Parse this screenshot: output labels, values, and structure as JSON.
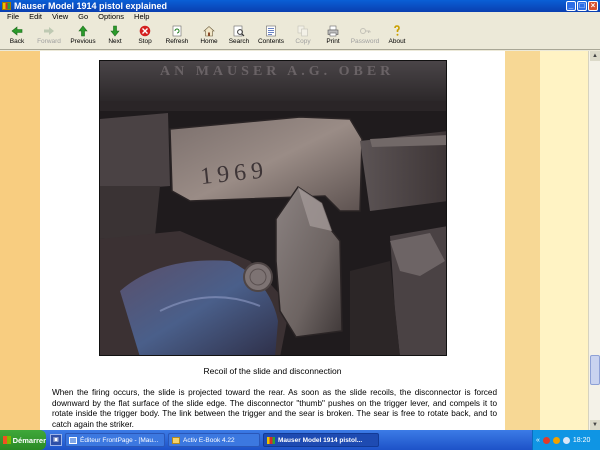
{
  "window": {
    "title": "Mauser Model 1914 pistol explained"
  },
  "menu": [
    "File",
    "Edit",
    "View",
    "Go",
    "Options",
    "Help"
  ],
  "toolbar": [
    {
      "label": "Back",
      "icon": "back-arrow-icon",
      "enabled": true
    },
    {
      "label": "Forward",
      "icon": "forward-arrow-icon",
      "enabled": false
    },
    {
      "label": "Previous",
      "icon": "up-arrow-icon",
      "enabled": true
    },
    {
      "label": "Next",
      "icon": "down-arrow-icon",
      "enabled": true
    },
    {
      "label": "Stop",
      "icon": "stop-icon",
      "enabled": true
    },
    {
      "label": "Refresh",
      "icon": "refresh-icon",
      "enabled": true
    },
    {
      "label": "Home",
      "icon": "home-icon",
      "enabled": true
    },
    {
      "label": "Search",
      "icon": "search-icon",
      "enabled": true
    },
    {
      "label": "Contents",
      "icon": "contents-icon",
      "enabled": true
    },
    {
      "label": "Copy",
      "icon": "copy-icon",
      "enabled": false
    },
    {
      "label": "Print",
      "icon": "print-icon",
      "enabled": true
    },
    {
      "label": "Password",
      "icon": "password-icon",
      "enabled": false
    },
    {
      "label": "About",
      "icon": "about-icon",
      "enabled": true
    }
  ],
  "content": {
    "photo_stamp": "1969",
    "photo_top_text": "AN MAUSER A.G. OBER",
    "caption": "Recoil of the slide and disconnection",
    "paragraph": "When the firing occurs, the slide is projected toward the rear. As soon as the slide recoils, the disconnector is forced downward by the flat surface of the slide edge. The disconnector \"thumb\" pushes on the trigger lever, and compels it to rotate inside the trigger body. The link between the trigger and the sear is broken. The sear is free to rotate back, and to catch again the striker."
  },
  "taskbar": {
    "start_label": "Démarrer",
    "tasks": [
      {
        "label": "Éditeur FrontPage - [Mau...",
        "active": false
      },
      {
        "label": "Activ E-Book 4.22",
        "active": false
      },
      {
        "label": "Mauser Model 1914 pistol...",
        "active": true
      }
    ],
    "clock": "18:20"
  },
  "colors": {
    "left_band": "#f8cd80",
    "right_band": "#f7d895",
    "title_bar": "#0a3fb0",
    "taskbar": "#1d52c8",
    "start": "#2a8a25"
  }
}
